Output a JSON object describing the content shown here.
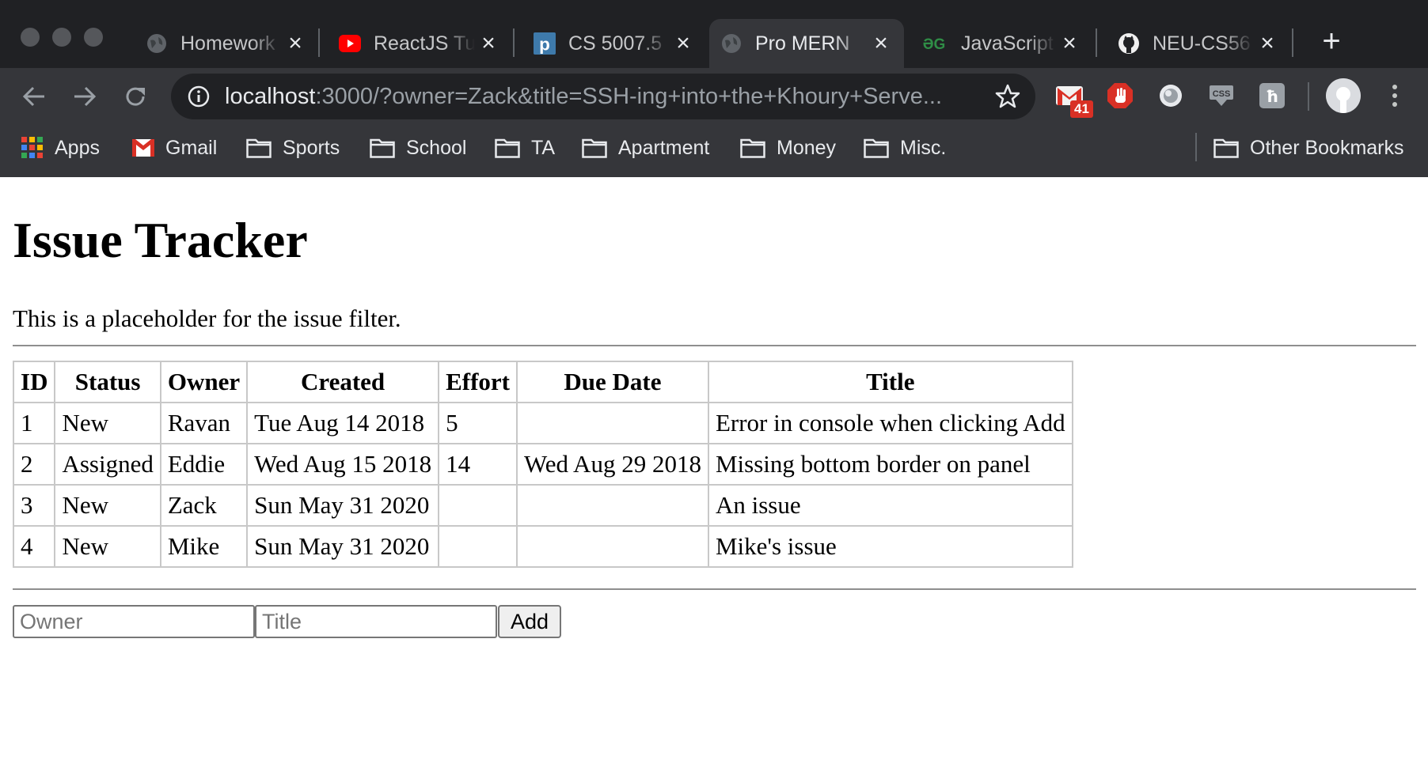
{
  "browser": {
    "tabs": [
      {
        "label": "Homework",
        "favicon": "globe-icon"
      },
      {
        "label": "ReactJS Tu",
        "favicon": "youtube-icon"
      },
      {
        "label": "CS 5007.5",
        "favicon": "piazza-icon"
      },
      {
        "label": "Pro MERN",
        "favicon": "globe-icon",
        "active": true
      },
      {
        "label": "JavaScript",
        "favicon": "geeksforgeeks-icon"
      },
      {
        "label": "NEU-CS56",
        "favicon": "github-icon"
      }
    ],
    "new_tab": "+",
    "url_host": "localhost",
    "url_path": ":3000/?owner=Zack&title=SSH-ing+into+the+Khoury+Serve...",
    "mail_badge": "41",
    "bookmarks": [
      {
        "label": "Apps",
        "icon": "apps-grid-icon"
      },
      {
        "label": "Gmail",
        "icon": "gmail-icon"
      },
      {
        "label": "Sports",
        "icon": "folder-icon"
      },
      {
        "label": "School",
        "icon": "folder-icon"
      },
      {
        "label": "TA",
        "icon": "folder-icon"
      },
      {
        "label": "Apartment",
        "icon": "folder-icon"
      },
      {
        "label": "Money",
        "icon": "folder-icon"
      },
      {
        "label": "Misc.",
        "icon": "folder-icon"
      }
    ],
    "other_bookmarks": "Other Bookmarks"
  },
  "page": {
    "title": "Issue Tracker",
    "filter_placeholder": "This is a placeholder for the issue filter.",
    "table": {
      "headers": [
        "ID",
        "Status",
        "Owner",
        "Created",
        "Effort",
        "Due Date",
        "Title"
      ],
      "rows": [
        [
          "1",
          "New",
          "Ravan",
          "Tue Aug 14 2018",
          "5",
          "",
          "Error in console when clicking Add"
        ],
        [
          "2",
          "Assigned",
          "Eddie",
          "Wed Aug 15 2018",
          "14",
          "Wed Aug 29 2018",
          "Missing bottom border on panel"
        ],
        [
          "3",
          "New",
          "Zack",
          "Sun May 31 2020",
          "",
          "",
          "An issue"
        ],
        [
          "4",
          "New",
          "Mike",
          "Sun May 31 2020",
          "",
          "",
          "Mike's issue"
        ]
      ]
    },
    "add_form": {
      "owner_placeholder": "Owner",
      "owner_value": "",
      "title_placeholder": "Title",
      "title_value": "",
      "add_label": "Add"
    }
  }
}
